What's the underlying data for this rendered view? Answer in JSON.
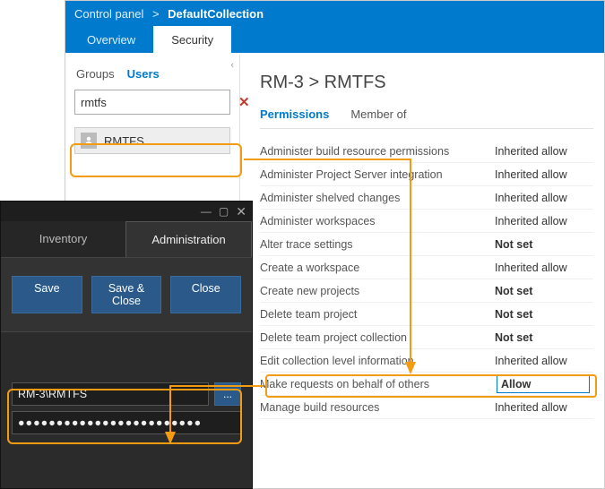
{
  "tfs": {
    "breadcrumb": {
      "root": "Control panel",
      "current": "DefaultCollection"
    },
    "tabs": {
      "overview": "Overview",
      "security": "Security"
    },
    "left": {
      "tabs": {
        "groups": "Groups",
        "users": "Users"
      },
      "search": {
        "value": "rmtfs"
      },
      "user": {
        "name": "RMTFS"
      }
    },
    "right": {
      "title": "RM-3 > RMTFS",
      "tabs": {
        "permissions": "Permissions",
        "memberof": "Member of"
      },
      "perms": [
        {
          "name": "Administer build resource permissions",
          "value": "Inherited allow",
          "bold": false
        },
        {
          "name": "Administer Project Server integration",
          "value": "Inherited allow",
          "bold": false
        },
        {
          "name": "Administer shelved changes",
          "value": "Inherited allow",
          "bold": false
        },
        {
          "name": "Administer workspaces",
          "value": "Inherited allow",
          "bold": false
        },
        {
          "name": "Alter trace settings",
          "value": "Not set",
          "bold": true
        },
        {
          "name": "Create a workspace",
          "value": "Inherited allow",
          "bold": false
        },
        {
          "name": "Create new projects",
          "value": "Not set",
          "bold": true
        },
        {
          "name": "Delete team project",
          "value": "Not set",
          "bold": true
        },
        {
          "name": "Delete team project collection",
          "value": "Not set",
          "bold": true
        },
        {
          "name": "Edit collection level information",
          "value": "Inherited allow",
          "bold": false
        },
        {
          "name": "Make requests on behalf of others",
          "value": "Allow",
          "bold": true,
          "selected": true
        },
        {
          "name": "Manage build resources",
          "value": "Inherited allow",
          "bold": false
        }
      ]
    }
  },
  "rm": {
    "tabs": {
      "inventory": "Inventory",
      "admin": "Administration"
    },
    "buttons": {
      "save": "Save",
      "saveclose": "Save & Close",
      "close": "Close"
    },
    "cred": {
      "user": "RM-3\\RMTFS",
      "browse": "...",
      "pw": "●●●●●●●●●●●●●●●●●●●●●●●●"
    }
  }
}
